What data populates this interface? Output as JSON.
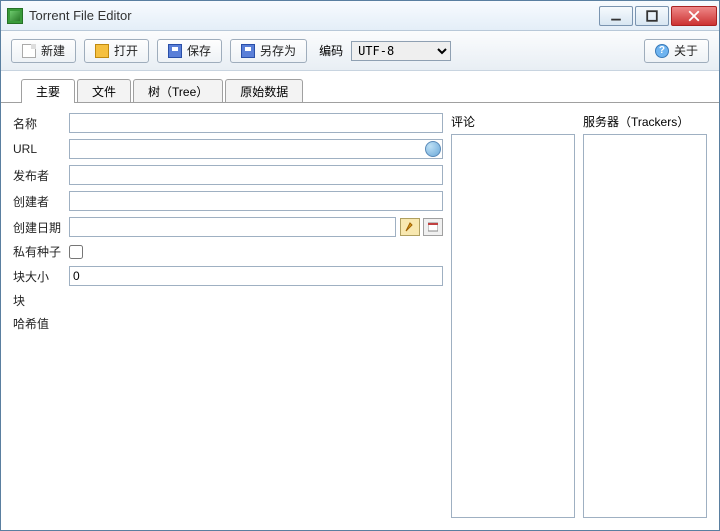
{
  "window": {
    "title": "Torrent File Editor"
  },
  "toolbar": {
    "new_label": "新建",
    "open_label": "打开",
    "save_label": "保存",
    "saveas_label": "另存为",
    "encoding_label": "编码",
    "encoding_value": "UTF-8",
    "about_label": "关于"
  },
  "tabs": {
    "main": "主要",
    "files": "文件",
    "tree": "树（Tree）",
    "raw": "原始数据"
  },
  "form": {
    "name_label": "名称",
    "name_value": "",
    "url_label": "URL",
    "url_value": "",
    "publisher_label": "发布者",
    "publisher_value": "",
    "creator_label": "创建者",
    "creator_value": "",
    "created_label": "创建日期",
    "created_value": "",
    "private_label": "私有种子",
    "private_checked": false,
    "piece_size_label": "块大小",
    "piece_size_value": "0",
    "pieces_label": "块",
    "pieces_value": "",
    "hash_label": "哈希值",
    "hash_value": ""
  },
  "panels": {
    "comments_label": "评论",
    "trackers_label": "服务器（Trackers）"
  }
}
